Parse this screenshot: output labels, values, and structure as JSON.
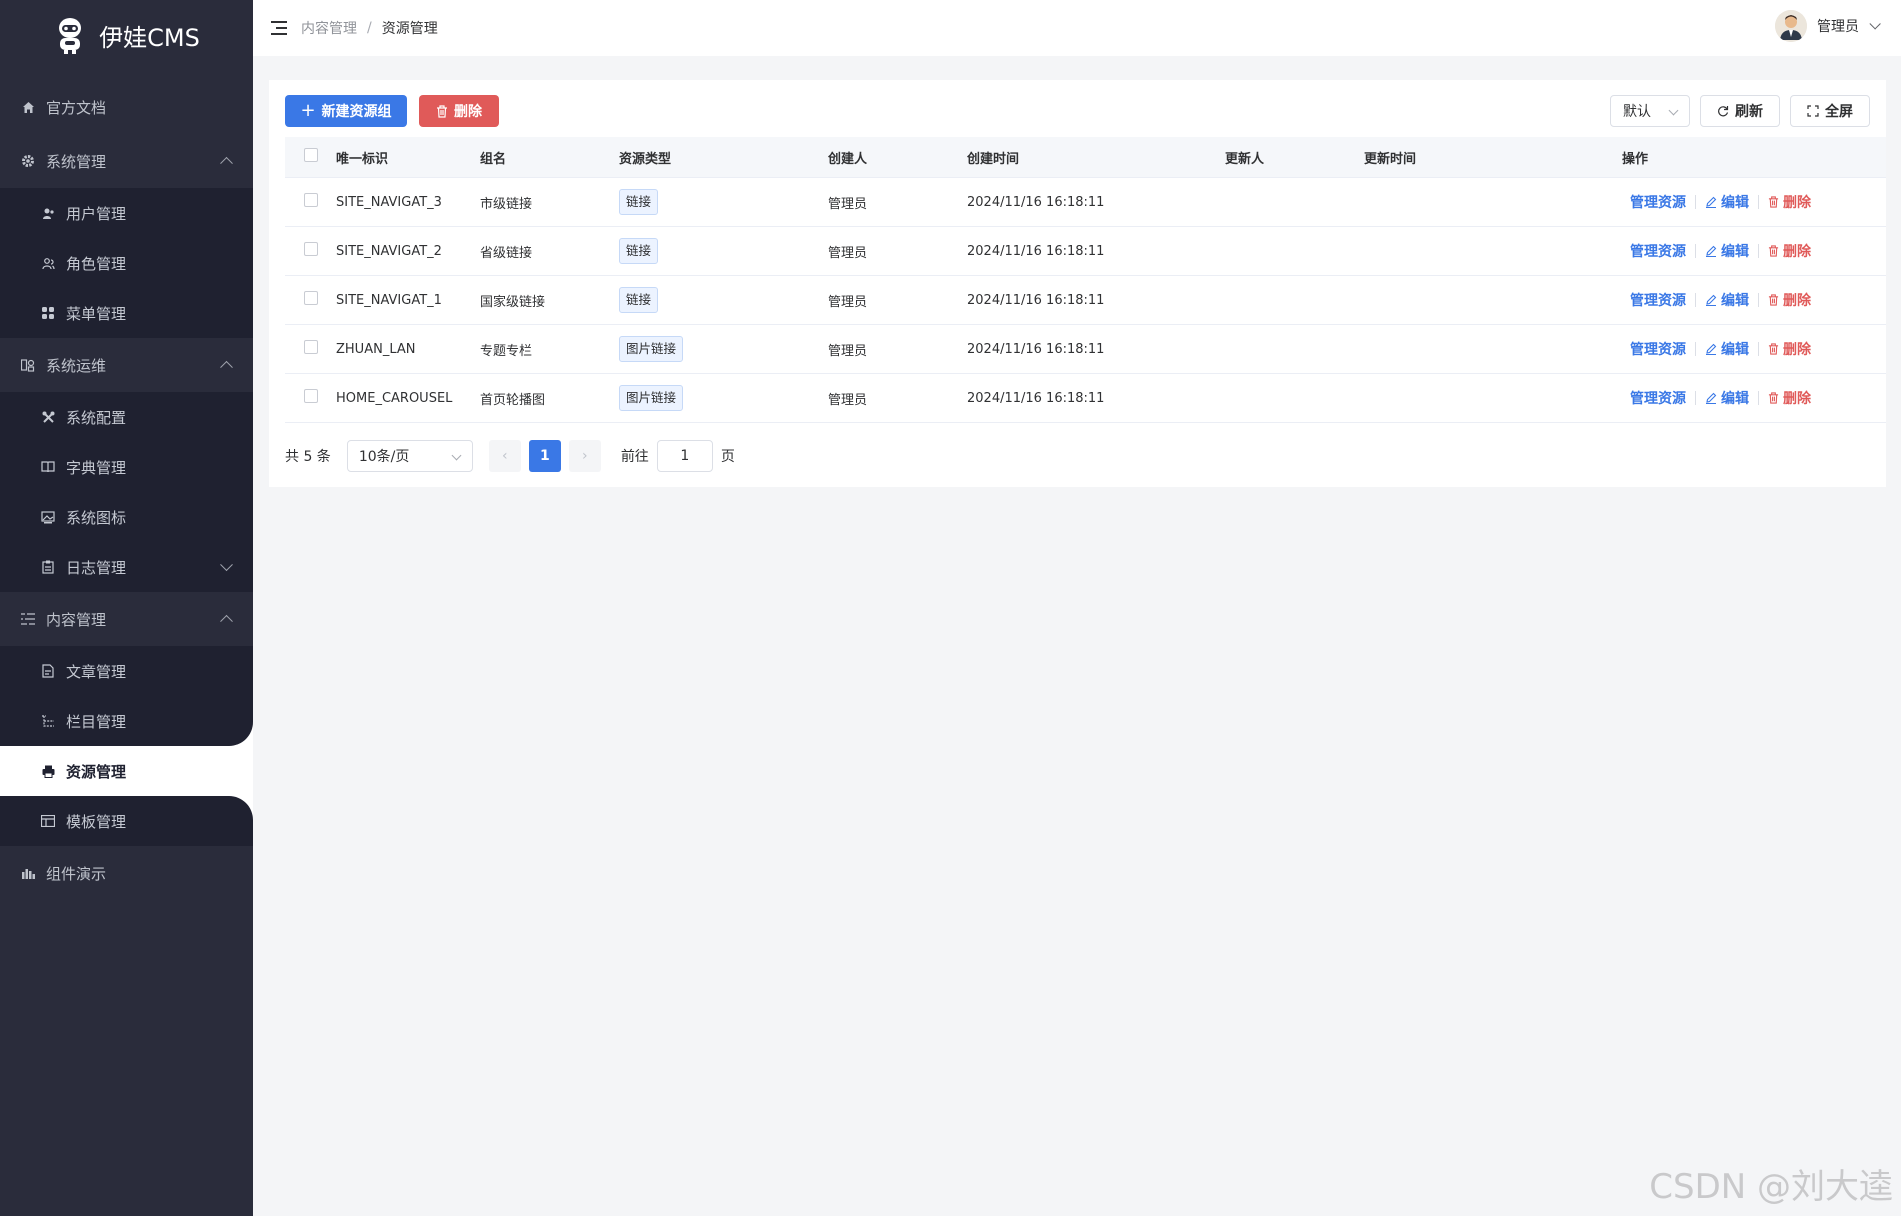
{
  "brand": {
    "name": "伊娃CMS"
  },
  "sidebar": {
    "docs": "官方文档",
    "system": {
      "label": "系统管理",
      "items": [
        "用户管理",
        "角色管理",
        "菜单管理"
      ]
    },
    "ops": {
      "label": "系统运维",
      "items": [
        "系统配置",
        "字典管理",
        "系统图标"
      ],
      "log": "日志管理"
    },
    "content": {
      "label": "内容管理",
      "items": [
        "文章管理",
        "栏目管理",
        "资源管理",
        "模板管理"
      ]
    },
    "demo": "组件演示"
  },
  "header": {
    "breadcrumb": [
      "内容管理",
      "资源管理"
    ],
    "user": "管理员"
  },
  "toolbar": {
    "new_group": "新建资源组",
    "delete": "删除",
    "size_select": "默认",
    "refresh": "刷新",
    "fullscreen": "全屏"
  },
  "table": {
    "columns": [
      "唯一标识",
      "组名",
      "资源类型",
      "创建人",
      "创建时间",
      "更新人",
      "更新时间",
      "操作"
    ],
    "rows": [
      {
        "key": "SITE_NAVIGAT_3",
        "name": "市级链接",
        "type": "链接",
        "creator": "管理员",
        "created": "2024/11/16 16:18:11",
        "updater": "",
        "updated": ""
      },
      {
        "key": "SITE_NAVIGAT_2",
        "name": "省级链接",
        "type": "链接",
        "creator": "管理员",
        "created": "2024/11/16 16:18:11",
        "updater": "",
        "updated": ""
      },
      {
        "key": "SITE_NAVIGAT_1",
        "name": "国家级链接",
        "type": "链接",
        "creator": "管理员",
        "created": "2024/11/16 16:18:11",
        "updater": "",
        "updated": ""
      },
      {
        "key": "ZHUAN_LAN",
        "name": "专题专栏",
        "type": "图片链接",
        "creator": "管理员",
        "created": "2024/11/16 16:18:11",
        "updater": "",
        "updated": ""
      },
      {
        "key": "HOME_CAROUSEL",
        "name": "首页轮播图",
        "type": "图片链接",
        "creator": "管理员",
        "created": "2024/11/16 16:18:11",
        "updater": "",
        "updated": ""
      }
    ],
    "actions": {
      "manage": "管理资源",
      "edit": "编辑",
      "delete": "删除"
    }
  },
  "pagination": {
    "total": "共 5 条",
    "page_size": "10条/页",
    "current": "1",
    "goto_label": "前往",
    "goto_value": "1",
    "page_suffix": "页"
  },
  "watermark": "CSDN @刘大逵",
  "colors": {
    "primary": "#3a78e6",
    "danger": "#e05a59",
    "sidebar": "#2a2c3b",
    "sidebar_sub": "#1f2130"
  }
}
